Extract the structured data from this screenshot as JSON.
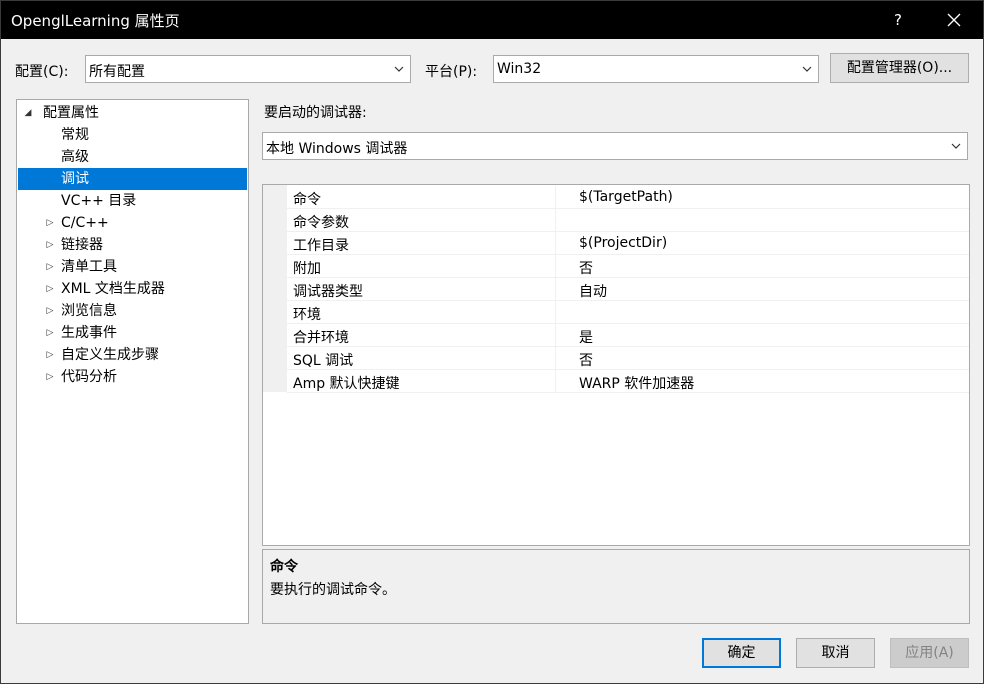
{
  "window": {
    "title": "OpenglLearning 属性页",
    "help_label": "?"
  },
  "config_bar": {
    "config_label": "配置(C):",
    "config_value": "所有配置",
    "platform_label": "平台(P):",
    "platform_value": "Win32",
    "config_manager_label": "配置管理器(O)..."
  },
  "tree": {
    "root_label": "配置属性",
    "items": [
      {
        "label": "常规",
        "expandable": false,
        "selected": false
      },
      {
        "label": "高级",
        "expandable": false,
        "selected": false
      },
      {
        "label": "调试",
        "expandable": false,
        "selected": true
      },
      {
        "label": "VC++ 目录",
        "expandable": false,
        "selected": false
      },
      {
        "label": "C/C++",
        "expandable": true,
        "selected": false
      },
      {
        "label": "链接器",
        "expandable": true,
        "selected": false
      },
      {
        "label": "清单工具",
        "expandable": true,
        "selected": false
      },
      {
        "label": "XML 文档生成器",
        "expandable": true,
        "selected": false
      },
      {
        "label": "浏览信息",
        "expandable": true,
        "selected": false
      },
      {
        "label": "生成事件",
        "expandable": true,
        "selected": false
      },
      {
        "label": "自定义生成步骤",
        "expandable": true,
        "selected": false
      },
      {
        "label": "代码分析",
        "expandable": true,
        "selected": false
      }
    ]
  },
  "debugger": {
    "label": "要启动的调试器:",
    "value": "本地 Windows 调试器"
  },
  "properties": [
    {
      "name": "命令",
      "value": "$(TargetPath)"
    },
    {
      "name": "命令参数",
      "value": ""
    },
    {
      "name": "工作目录",
      "value": "$(ProjectDir)"
    },
    {
      "name": "附加",
      "value": "否"
    },
    {
      "name": "调试器类型",
      "value": "自动"
    },
    {
      "name": "环境",
      "value": ""
    },
    {
      "name": "合并环境",
      "value": "是"
    },
    {
      "name": "SQL 调试",
      "value": "否"
    },
    {
      "name": "Amp 默认快捷键",
      "value": "WARP 软件加速器"
    }
  ],
  "description": {
    "title": "命令",
    "text": "要执行的调试命令。"
  },
  "buttons": {
    "ok_label": "确定",
    "cancel_label": "取消",
    "apply_label": "应用(A)"
  },
  "colors": {
    "selection": "#0078d7",
    "titlebar": "#000000",
    "dialog_bg": "#f0f0f0"
  }
}
